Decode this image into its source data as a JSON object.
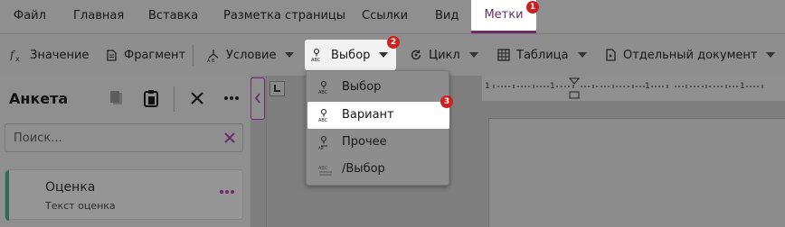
{
  "ribbon": {
    "tabs": [
      {
        "label": "Файл"
      },
      {
        "label": "Главная"
      },
      {
        "label": "Вставка"
      },
      {
        "label": "Разметка страницы"
      },
      {
        "label": "Ссылки"
      },
      {
        "label": "Вид"
      },
      {
        "label": "Метки",
        "active": true
      }
    ],
    "active_tab": "Метки",
    "accent_color": "#6b2a68"
  },
  "toolbar": {
    "value_label": "Значение",
    "fragment_label": "Фрагмент",
    "condition_label": "Условие",
    "choice_label": "Выбор",
    "loop_label": "Цикл",
    "table_label": "Таблица",
    "separate_doc_label": "Отдельный документ"
  },
  "badges": {
    "tab": "1",
    "choice": "2",
    "variant": "3",
    "color": "#d01f1f"
  },
  "choice_menu": {
    "items": [
      {
        "label": "Выбор",
        "icon": "choice-icon"
      },
      {
        "label": "Вариант",
        "icon": "variant-icon",
        "highlighted": true
      },
      {
        "label": "Прочее",
        "icon": "other-icon"
      },
      {
        "label": "/Выбор",
        "icon": "end-choice-icon"
      }
    ]
  },
  "pane": {
    "title": "Анкета",
    "search_placeholder": "Поиск...",
    "card": {
      "title": "Оценка",
      "subtitle": "Текст оценка"
    }
  },
  "ruler": {
    "labels": [
      "1",
      "1",
      "1",
      "1"
    ]
  }
}
